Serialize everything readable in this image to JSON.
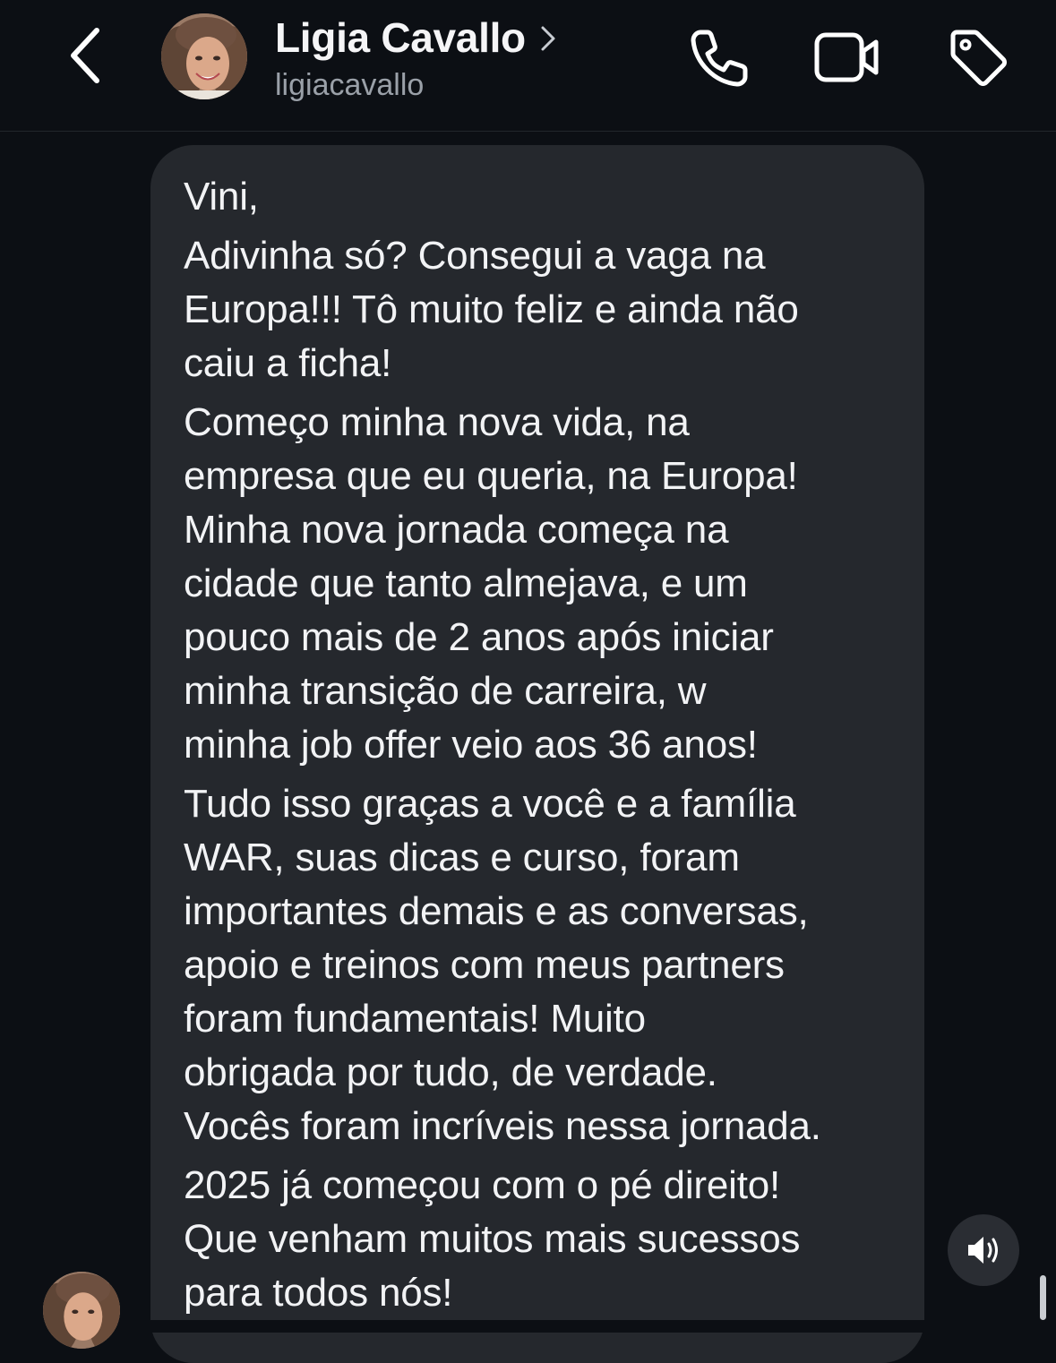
{
  "header": {
    "back_icon": "chevron-left-icon",
    "contact_name": "Ligia Cavallo",
    "username": "ligiacavallo",
    "actions": [
      {
        "icon": "phone-icon"
      },
      {
        "icon": "video-camera-icon"
      },
      {
        "icon": "tag-icon"
      }
    ]
  },
  "message": {
    "paragraphs": [
      "Vini,",
      "Adivinha só? Consegui a vaga na\nEuropa!!!  Tô muito feliz e ainda não\ncaiu a ficha!",
      "Começo minha nova vida, na\nempresa que eu queria, na Europa!\nMinha nova jornada começa na\ncidade que tanto almejava, e um\npouco mais de 2 anos após iniciar\nminha transição de carreira, w\nminha job offer veio aos 36 anos!",
      "Tudo isso graças a você e a família\nWAR, suas dicas e curso, foram\nimportantes demais e as conversas,\napoio e treinos com meus partners\nforam fundamentais!  Muito\nobrigada por tudo, de verdade.\nVocês foram incríveis nessa jornada.",
      "2025 já começou com o pé direito!\nQue venham muitos mais sucessos\npara todos nós!"
    ]
  },
  "controls": {
    "speaker_icon": "speaker-volume-icon"
  },
  "colors": {
    "background": "#0c0f14",
    "bubble": "#25282d",
    "text": "#f2f3f5",
    "secondary_text": "#9aa0a8"
  }
}
